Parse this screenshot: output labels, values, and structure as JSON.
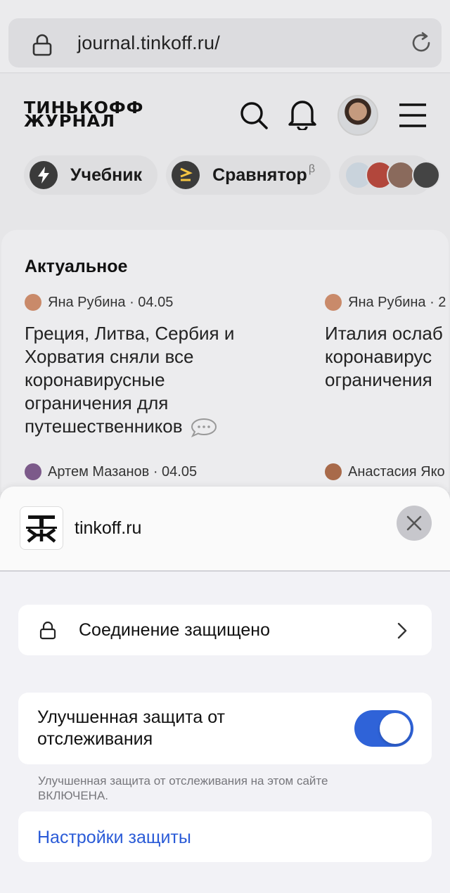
{
  "browser": {
    "url": "journal.tinkoff.ru/"
  },
  "site_header": {
    "logo_line1": "ТИНЬКОФФ",
    "logo_line2": "ЖУРНАЛ"
  },
  "chips": [
    {
      "label": "Учебник",
      "icon": "lightning-icon"
    },
    {
      "label": "Сравнятор",
      "sup": "β",
      "icon": "compare-icon"
    }
  ],
  "feed": {
    "title": "Актуальное",
    "articles": [
      {
        "author": "Яна Рубина",
        "date": "· 04.05",
        "title": "Греция, Литва, Сербия и Хорватия сняли все коронавирусные ограничения для путешественников"
      },
      {
        "author": "Яна Рубина",
        "date": "· 2",
        "title": "Италия ослаб коронавирус ограничения"
      }
    ],
    "next_row": [
      {
        "author": "Артем Мазанов",
        "date": "· 04.05"
      },
      {
        "author": "Анастасия Яко",
        "date": ""
      }
    ]
  },
  "sheet": {
    "site_name": "tinkoff.ru",
    "site_logo_line1": "Т",
    "site_logo_line2": "Ж",
    "connection_label": "Соединение защищено",
    "tracking_label": "Улучшенная защита от отслеживания",
    "tracking_enabled": true,
    "tracking_note": "Улучшенная защита от отслеживания на этом сайте ВКЛЮЧЕНА.",
    "settings_link": "Настройки защиты"
  },
  "colors": {
    "accent_blue": "#2f63d8",
    "toggle_on": "#2f63d8",
    "compare_icon_bg": "#3b3b3b",
    "compare_icon_fg": "#f5c542"
  }
}
